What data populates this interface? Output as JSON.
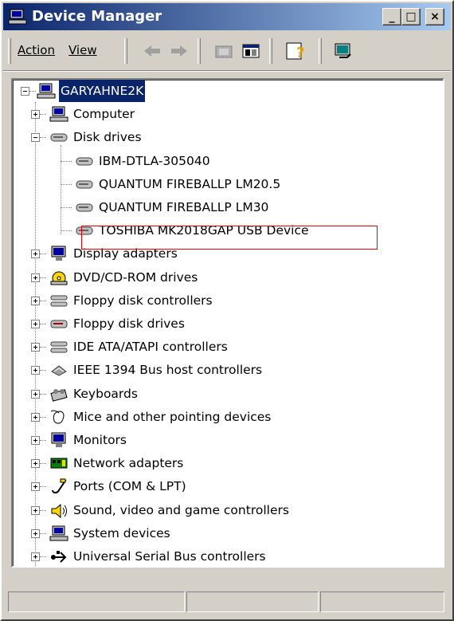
{
  "window": {
    "title": "Device Manager"
  },
  "caption": {
    "minimize": "_",
    "maximize": "□",
    "close": "×"
  },
  "menu": {
    "action": "Action",
    "view": "View"
  },
  "tree": {
    "root": "GARYAHNE2K",
    "categories": [
      "Computer",
      "Disk drives",
      "Display adapters",
      "DVD/CD-ROM drives",
      "Floppy disk controllers",
      "Floppy disk drives",
      "IDE ATA/ATAPI controllers",
      "IEEE 1394 Bus host controllers",
      "Keyboards",
      "Mice and other pointing devices",
      "Monitors",
      "Network adapters",
      "Ports (COM & LPT)",
      "Sound, video and game controllers",
      "System devices",
      "Universal Serial Bus controllers"
    ],
    "disk_drives": [
      "IBM-DTLA-305040",
      "QUANTUM FIREBALLP LM20.5",
      "QUANTUM FIREBALLP LM30",
      "TOSHIBA MK2018GAP USB Device"
    ]
  },
  "colors": {
    "title_start": "#0a246a",
    "title_end": "#a6caf0",
    "highlight": "#e00000"
  }
}
